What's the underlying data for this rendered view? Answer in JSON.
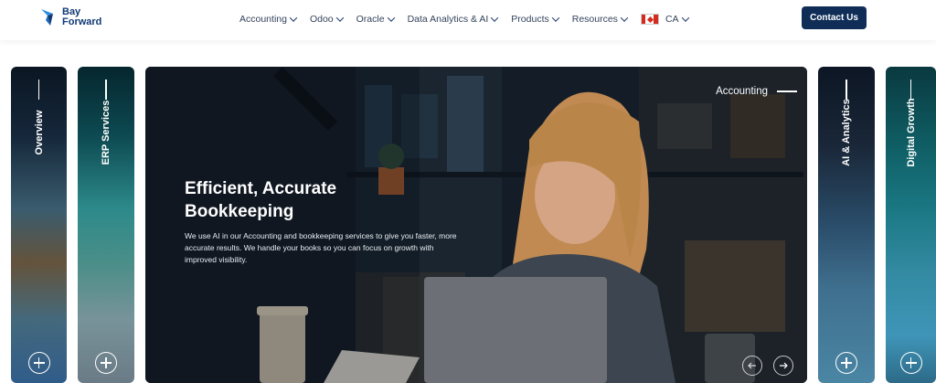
{
  "brand": {
    "line1": "Bay",
    "line2": "Forward",
    "color": "#103a74"
  },
  "nav": {
    "items": [
      {
        "label": "Accounting"
      },
      {
        "label": "Odoo"
      },
      {
        "label": "Oracle"
      },
      {
        "label": "Data Analytics & AI"
      },
      {
        "label": "Products"
      },
      {
        "label": "Resources"
      }
    ],
    "locale": {
      "label": "CA",
      "icon": "canada-flag-icon"
    },
    "contact_label": "Contact Us",
    "contact_color": "#0f2d57"
  },
  "panels": {
    "overview": "Overview",
    "erp": "ERP Services",
    "ai": "AI & Analytics",
    "digital": "Digital Growth"
  },
  "hero": {
    "category": "Accounting",
    "title_line1": "Efficient, Accurate",
    "title_line2": "Bookkeeping",
    "description": "We use AI in our Accounting and bookkeeping services to give you faster, more accurate results. We handle your books so you can focus on growth with improved visibility.",
    "prev_icon": "arrow-left-icon",
    "next_icon": "arrow-right-icon"
  }
}
